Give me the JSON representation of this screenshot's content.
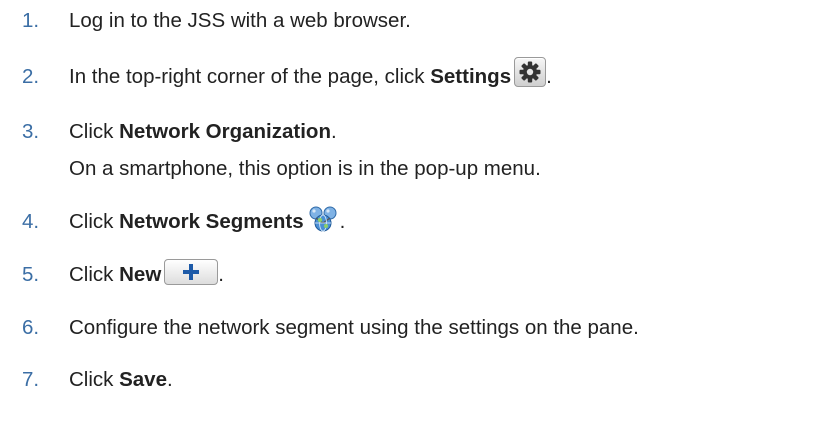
{
  "steps": [
    {
      "num": "1.",
      "parts": {
        "pre": "Log in to the JSS with a web browser."
      }
    },
    {
      "num": "2.",
      "parts": {
        "pre": "In the top-right corner of the page, click ",
        "bold": "Settings",
        "post": "."
      },
      "icon": "gear-icon"
    },
    {
      "num": "3.",
      "parts": {
        "pre": "Click ",
        "bold": "Network Organization",
        "post": "."
      },
      "note": "On a smartphone, this option is in the pop-up menu."
    },
    {
      "num": "4.",
      "parts": {
        "pre": "Click ",
        "bold": "Network Segments",
        "post": "."
      },
      "icon": "network-globe-icon"
    },
    {
      "num": "5.",
      "parts": {
        "pre": "Click ",
        "bold": "New",
        "post": "."
      },
      "icon": "plus-icon"
    },
    {
      "num": "6.",
      "parts": {
        "pre": "Configure the network segment using the settings on the pane."
      }
    },
    {
      "num": "7.",
      "parts": {
        "pre": "Click ",
        "bold": "Save",
        "post": "."
      }
    }
  ],
  "colors": {
    "number": "#3b6ea5",
    "text": "#222222",
    "plus": "#1d5aa8"
  }
}
